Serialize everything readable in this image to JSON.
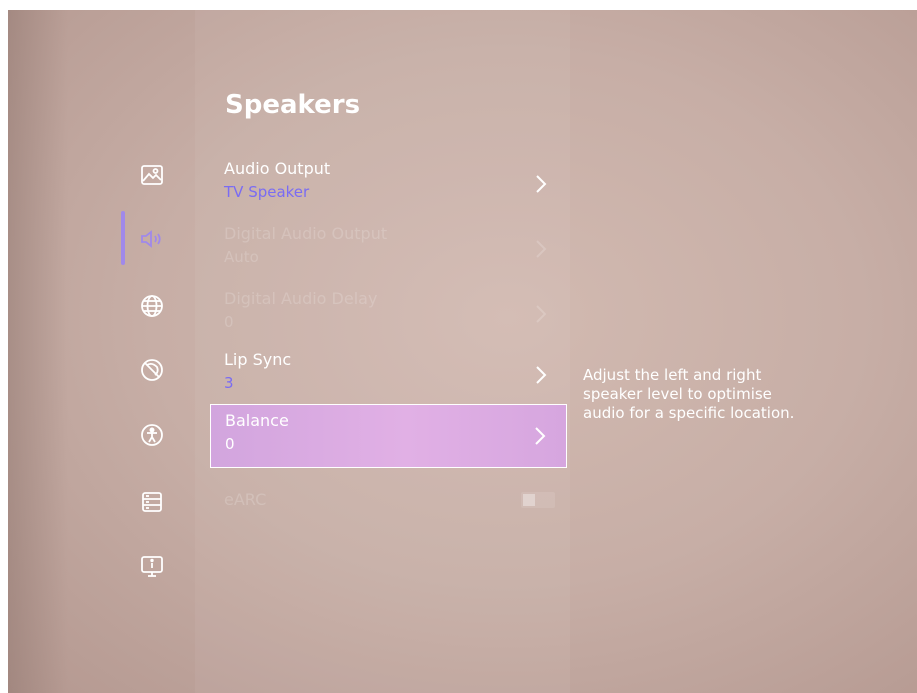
{
  "page": {
    "title": "Speakers"
  },
  "sidebar": {
    "items": [
      {
        "icon": "picture-icon",
        "active": false
      },
      {
        "icon": "sound-icon",
        "active": true
      },
      {
        "icon": "globe-icon",
        "active": false
      },
      {
        "icon": "no-disturb-icon",
        "active": false
      },
      {
        "icon": "accessibility-icon",
        "active": false
      },
      {
        "icon": "storage-icon",
        "active": false
      },
      {
        "icon": "info-screen-icon",
        "active": false
      }
    ]
  },
  "menu": {
    "items": [
      {
        "label": "Audio Output",
        "value": "TV Speaker",
        "enabled": true,
        "selected": false
      },
      {
        "label": "Digital Audio Output",
        "value": "Auto",
        "enabled": false,
        "selected": false
      },
      {
        "label": "Digital Audio Delay",
        "value": "0",
        "enabled": false,
        "selected": false
      },
      {
        "label": "Lip Sync",
        "value": "3",
        "enabled": true,
        "selected": false
      },
      {
        "label": "Balance",
        "value": "0",
        "enabled": true,
        "selected": true
      },
      {
        "label": "eARC",
        "value": "",
        "enabled": false,
        "selected": false,
        "type": "toggle"
      }
    ]
  },
  "help_text": "Adjust the left and right speaker level to optimise audio for a specific location.",
  "colors": {
    "value_text": "#7a6cf3",
    "active_indicator": "#a089ea",
    "selected_bg": "#dcaae2"
  }
}
